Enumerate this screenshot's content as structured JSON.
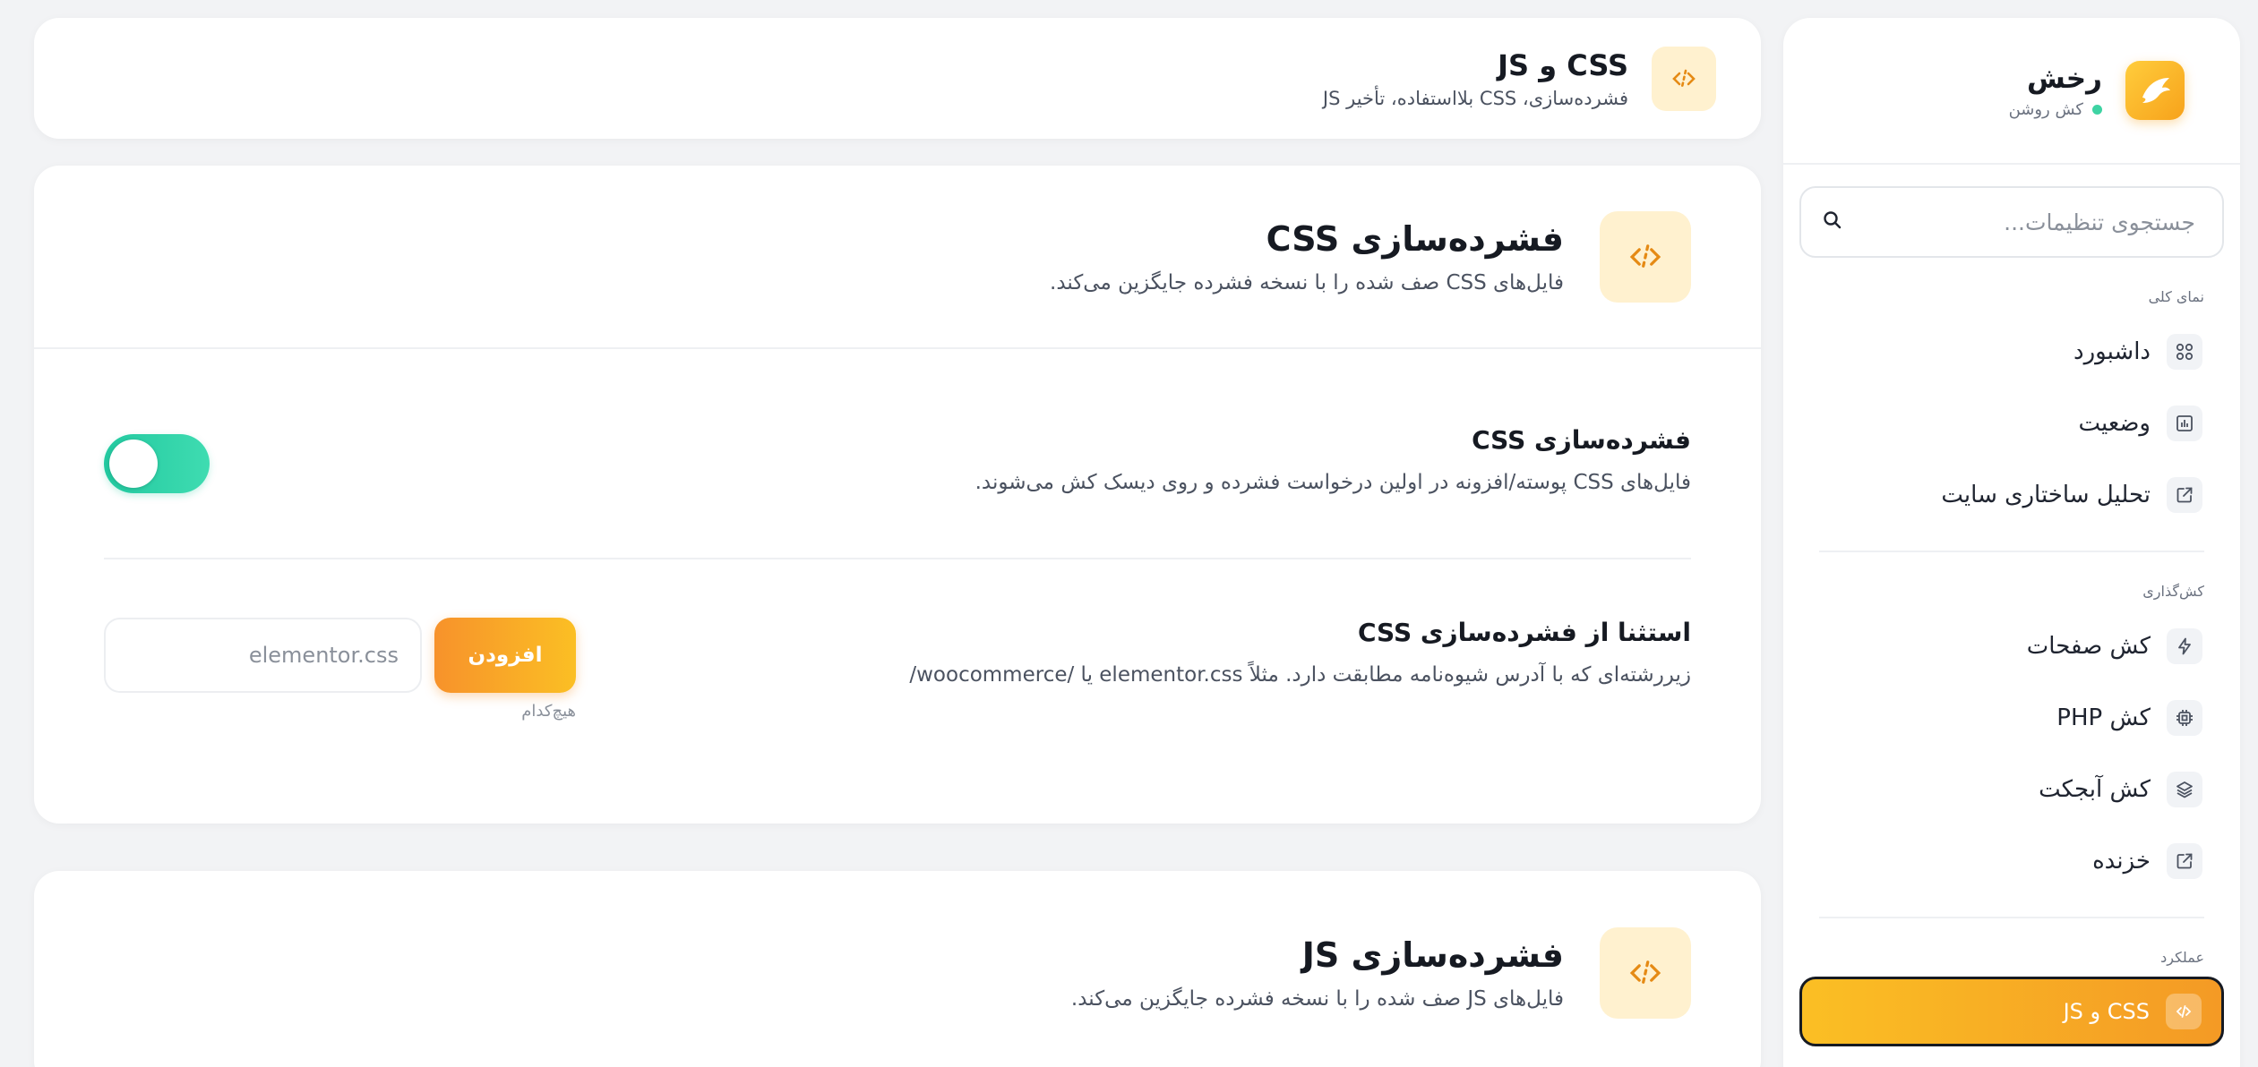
{
  "sidebar": {
    "brand": {
      "name": "رخش",
      "status": "کش روشن",
      "status_color": "#3ed3a3",
      "logo_icon": "horse-logo"
    },
    "search": {
      "placeholder": "جستجوی تنظیمات..."
    },
    "sections": [
      {
        "label": "نمای کلی",
        "items": [
          {
            "label": "داشبورد",
            "icon": "grid-icon"
          },
          {
            "label": "وضعیت",
            "icon": "chart-icon"
          },
          {
            "label": "تحلیل ساختاری سایت",
            "icon": "external-link-icon"
          }
        ]
      },
      {
        "label": "کش‌گذاری",
        "items": [
          {
            "label": "کش صفحات",
            "icon": "bolt-icon"
          },
          {
            "label": "کش PHP",
            "icon": "cpu-icon"
          },
          {
            "label": "کش آبجکت",
            "icon": "layers-icon"
          },
          {
            "label": "خزنده",
            "icon": "external-link-icon"
          }
        ]
      },
      {
        "label": "عملکرد",
        "items": [
          {
            "label": "CSS و JS",
            "icon": "code-icon",
            "active": true
          }
        ]
      }
    ]
  },
  "header": {
    "title": "CSS و JS",
    "subtitle": "فشرده‌سازی، CSS بلااستفاده، تأخیر JS"
  },
  "css_section": {
    "title": "فشرده‌سازی CSS",
    "description": "فایل‌های CSS صف شده را با نسخه فشرده جایگزین می‌کند.",
    "minify_row": {
      "title": "فشرده‌سازی CSS",
      "description": "فایل‌های CSS پوسته/افزونه در اولین درخواست فشرده و روی دیسک کش می‌شوند.",
      "enabled": true
    },
    "exclude_row": {
      "title": "استثنا از فشرده‌سازی CSS",
      "description": "زیررشته‌ای که با آدرس شیوه‌نامه مطابقت دارد. مثلاً elementor.css یا /woocommerce/",
      "input_placeholder": "elementor.css",
      "add_label": "افزودن",
      "empty_label": "هیچ‌کدام"
    }
  },
  "js_section": {
    "title": "فشرده‌سازی JS",
    "description": "فایل‌های JS صف شده را با نسخه فشرده جایگزین می‌کند."
  },
  "colors": {
    "accent": "#f7a21b",
    "toggle_on": "#2fd3a8",
    "icon_bg": "#fff1cf"
  }
}
